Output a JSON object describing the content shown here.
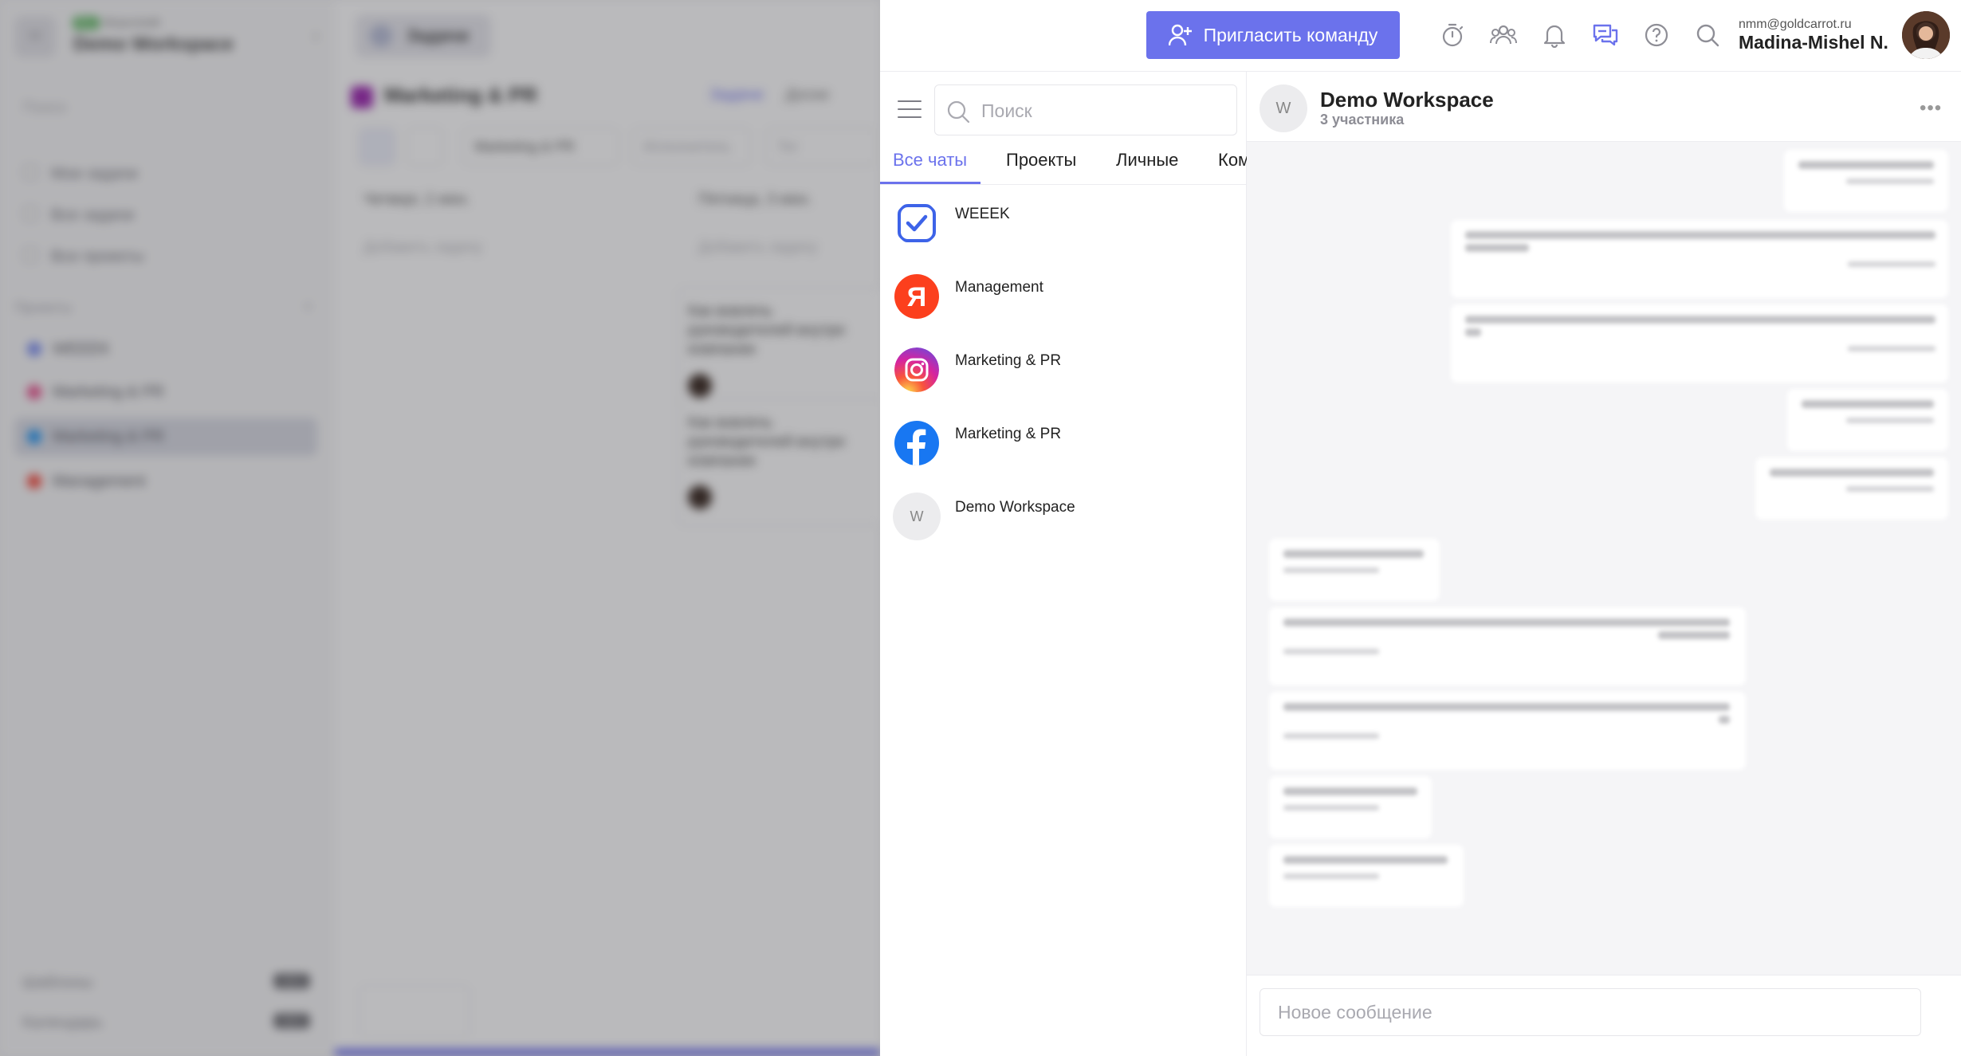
{
  "background": {
    "workspace": {
      "badge_tag": "Pro",
      "badge_label": "Bizpro/edit",
      "avatar": "W",
      "name": "Demo Workspace"
    },
    "search_placeholder": "Поиск",
    "nav": [
      "Мои задачи",
      "Все задачи",
      "Все проекты"
    ],
    "projects_label": "Проекты",
    "projects": [
      {
        "name": "WEEEK",
        "color": "#7a8cf0"
      },
      {
        "name": "Marketing & PR",
        "color": "#e84b8a"
      },
      {
        "name": "Marketing & PR",
        "color": "#2196f3"
      },
      {
        "name": "Management",
        "color": "#f44336"
      }
    ],
    "footer": [
      {
        "label": "Шаблоны",
        "badge": "NEW"
      },
      {
        "label": "Календарь",
        "badge": "NEW"
      }
    ],
    "tab_label": "Задачи",
    "project_title": "Marketing & PR",
    "views": {
      "active": "Задачи",
      "other": "Доски"
    },
    "filters": [
      "Marketing & PR",
      "Исполнитель",
      "Тег"
    ],
    "columns": [
      {
        "head": "Четверг, 2 июн.",
        "add": "Добавить задачу"
      },
      {
        "head": "Пятница, 3 июн.",
        "add": "Добавить задачу"
      }
    ],
    "cards": [
      "Как вовлечь руководителей внутри компании",
      "Как вовлечь руководителей внутри компании"
    ]
  },
  "topbar": {
    "invite_label": "Пригласить команду",
    "icons": [
      "timer-icon",
      "team-icon",
      "bell-icon",
      "chat-icon",
      "help-icon",
      "search-icon"
    ],
    "user_email": "nmm@goldcarrot.ru",
    "user_name": "Madina-Mishel N."
  },
  "chat_list": {
    "search_placeholder": "Поиск",
    "tabs": [
      "Все чаты",
      "Проекты",
      "Личные",
      "Ком"
    ],
    "active_tab": "Все чаты",
    "chats": [
      {
        "name": "WEEEK",
        "icon": "weeek-check-icon"
      },
      {
        "name": "Management",
        "icon": "yandex-icon"
      },
      {
        "name": "Marketing & PR",
        "icon": "instagram-icon"
      },
      {
        "name": "Marketing & PR",
        "icon": "facebook-icon"
      },
      {
        "name": "Demo Workspace",
        "icon": "workspace-avatar-icon",
        "avatar_letter": "W"
      }
    ]
  },
  "conversation": {
    "avatar_letter": "W",
    "title": "Demo Workspace",
    "subtitle": "3 участника",
    "compose_placeholder": "Новое сообщение"
  },
  "colors": {
    "accent": "#6b72ec",
    "facebook": "#1877f2",
    "yandex": "#fc3f1d"
  }
}
